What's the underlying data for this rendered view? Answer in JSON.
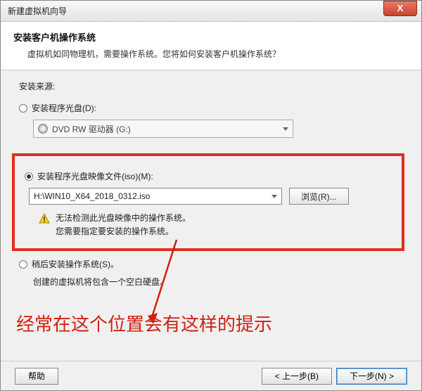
{
  "window": {
    "title": "新建虚拟机向导",
    "close_glyph": "X"
  },
  "header": {
    "title": "安装客户机操作系统",
    "subtitle": "虚拟机如同物理机，需要操作系统。您将如何安装客户机操作系统？"
  },
  "source_label": "安装来源:",
  "option_disc": {
    "label": "安装程序光盘(D):",
    "drive": "DVD RW 驱动器 (G:)"
  },
  "option_iso": {
    "label": "安装程序光盘映像文件(iso)(M):",
    "path": "H:\\WIN10_X64_2018_0312.iso",
    "browse": "浏览(R)...",
    "warn_line1": "无法检测此光盘映像中的操作系统。",
    "warn_line2": "您需要指定要安装的操作系统。"
  },
  "option_later": {
    "label": "稍后安装操作系统(S)。",
    "hint": "创建的虚拟机将包含一个空白硬盘。"
  },
  "annotation": "经常在这个位置会有这样的提示",
  "footer": {
    "help": "帮助",
    "back": "< 上一步(B)",
    "next": "下一步(N) >"
  }
}
